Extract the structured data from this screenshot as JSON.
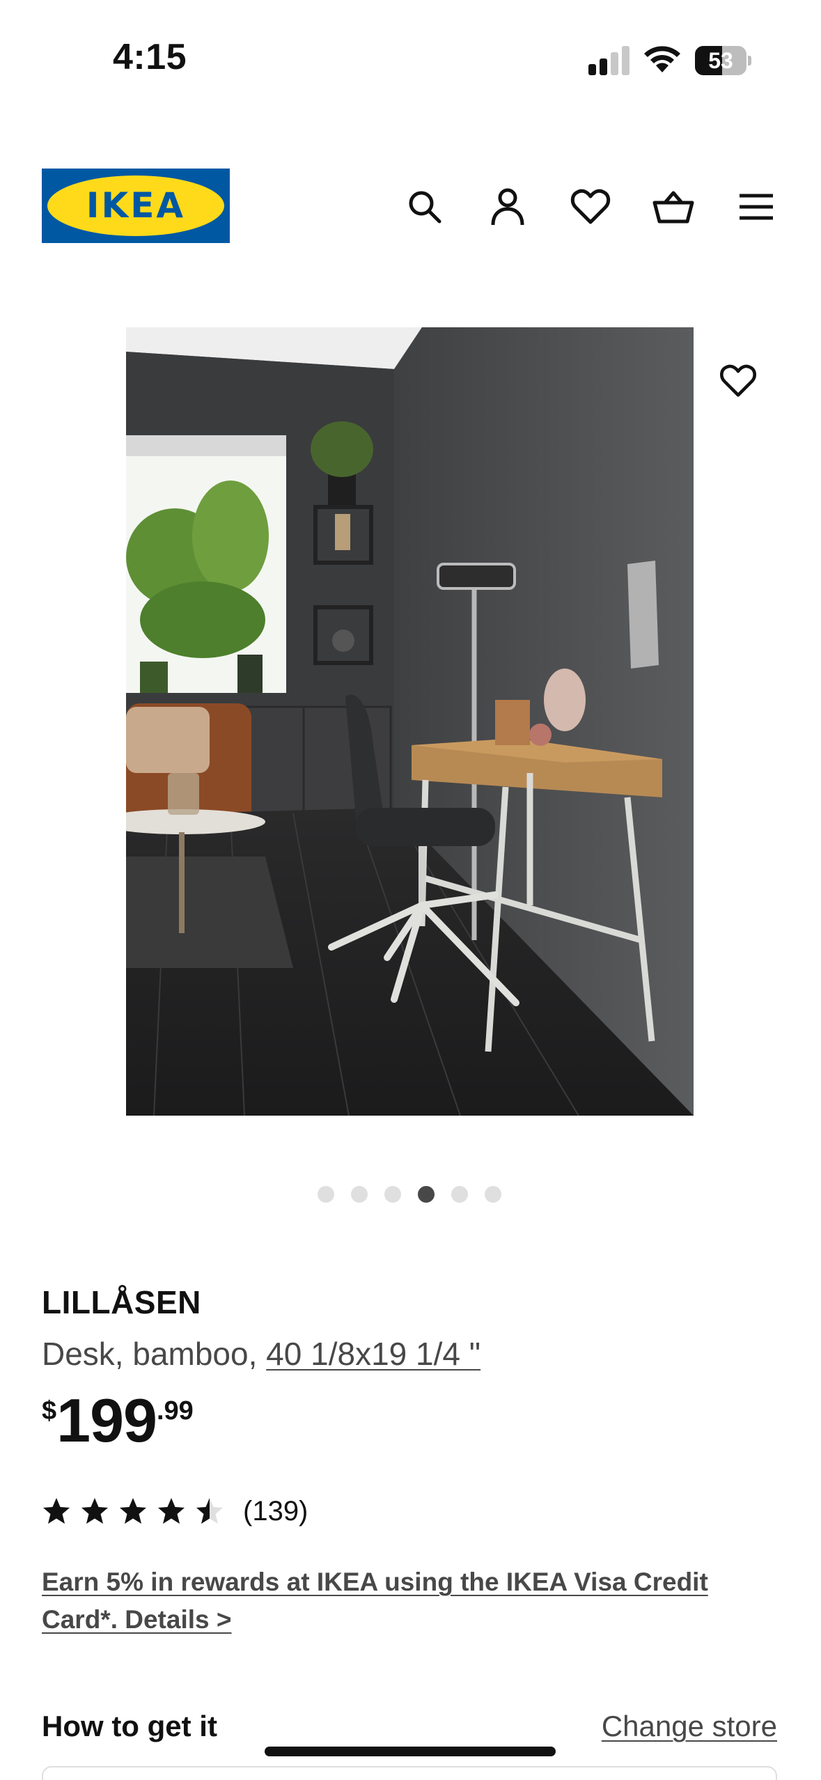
{
  "status_bar": {
    "time": "4:15",
    "battery_level": "53",
    "battery_fraction": 0.53,
    "signal_bars_active": 2,
    "signal_bars_total": 4
  },
  "header": {
    "logo_text": "IKEA",
    "logo_colors": {
      "blue": "#0058a3",
      "yellow": "#ffda1a"
    },
    "icons": [
      "search-icon",
      "account-icon",
      "heart-icon",
      "basket-icon",
      "menu-icon"
    ]
  },
  "gallery": {
    "total_images": 6,
    "active_index": 3,
    "image_subject": "desk-room-photo"
  },
  "product": {
    "name": "LILLÅSEN",
    "description_prefix": "Desk, bamboo, ",
    "measurement": "40 1/8x19 1/4 \"",
    "price_currency": "$",
    "price_integer": "199",
    "price_decimal": ".99",
    "rating_value": 4.5,
    "rating_max": 5,
    "rating_count": "(139)"
  },
  "promo": {
    "text": "Earn 5% in rewards at IKEA using the IKEA Visa Credit Card*. Details >"
  },
  "fulfillment": {
    "title": "How to get it",
    "change_store_label": "Change store"
  }
}
